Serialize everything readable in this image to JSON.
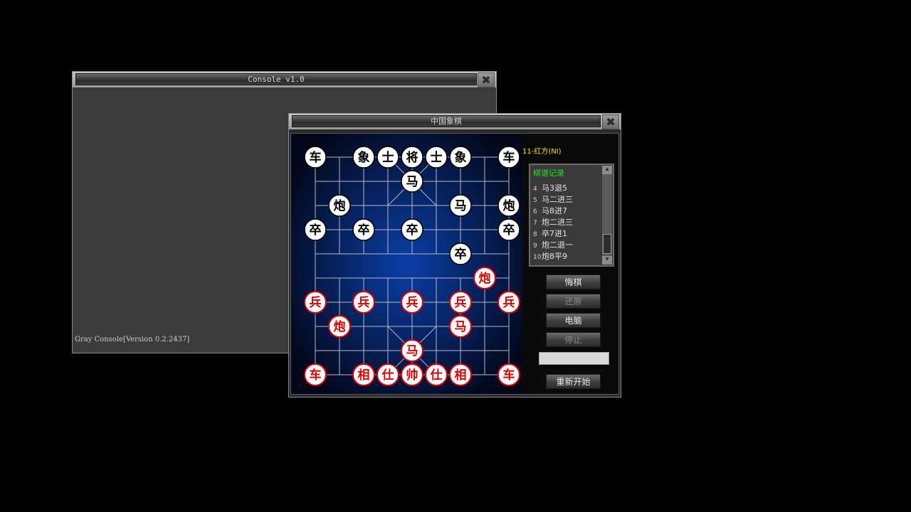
{
  "console": {
    "title": "Console v1.0",
    "close_glyph": "✖",
    "text": "Gray Console[Version 0.2.2437]"
  },
  "chess": {
    "title": "中国象棋",
    "close_glyph": "✖",
    "turn_label": "11-红方(NI)",
    "record": {
      "title": "棋谱记录",
      "moves": [
        {
          "num": "4",
          "text": "马3退5"
        },
        {
          "num": "5",
          "text": "马二进三"
        },
        {
          "num": "6",
          "text": "马8进7"
        },
        {
          "num": "7",
          "text": "炮二进三"
        },
        {
          "num": "8",
          "text": "卒7进1"
        },
        {
          "num": "9",
          "text": "炮二退一"
        },
        {
          "num": "10",
          "text": "炮8平9"
        }
      ],
      "scroll_up": "⯅",
      "scroll_down": "⯆"
    },
    "buttons": {
      "undo": "悔棋",
      "redo": "还原",
      "computer": "电脑",
      "stop": "停止",
      "restart": "重新开始"
    },
    "input_value": "",
    "colors": {
      "red": "#e00000",
      "black": "#000000",
      "board_center": "#0a3fa8",
      "board_edge": "#02071a",
      "line": "#b8b8c8"
    },
    "pieces": [
      {
        "char": "车",
        "side": "black",
        "col": 0,
        "row": 0
      },
      {
        "char": "象",
        "side": "black",
        "col": 2,
        "row": 0
      },
      {
        "char": "士",
        "side": "black",
        "col": 3,
        "row": 0
      },
      {
        "char": "将",
        "side": "black",
        "col": 4,
        "row": 0
      },
      {
        "char": "士",
        "side": "black",
        "col": 5,
        "row": 0
      },
      {
        "char": "象",
        "side": "black",
        "col": 6,
        "row": 0
      },
      {
        "char": "车",
        "side": "black",
        "col": 8,
        "row": 0
      },
      {
        "char": "马",
        "side": "black",
        "col": 4,
        "row": 1
      },
      {
        "char": "炮",
        "side": "black",
        "col": 1,
        "row": 2
      },
      {
        "char": "马",
        "side": "black",
        "col": 6,
        "row": 2
      },
      {
        "char": "炮",
        "side": "black",
        "col": 8,
        "row": 2
      },
      {
        "char": "卒",
        "side": "black",
        "col": 0,
        "row": 3
      },
      {
        "char": "卒",
        "side": "black",
        "col": 2,
        "row": 3
      },
      {
        "char": "卒",
        "side": "black",
        "col": 4,
        "row": 3
      },
      {
        "char": "卒",
        "side": "black",
        "col": 8,
        "row": 3
      },
      {
        "char": "卒",
        "side": "black",
        "col": 6,
        "row": 4
      },
      {
        "char": "炮",
        "side": "red",
        "col": 7,
        "row": 5
      },
      {
        "char": "兵",
        "side": "red",
        "col": 0,
        "row": 6
      },
      {
        "char": "兵",
        "side": "red",
        "col": 2,
        "row": 6
      },
      {
        "char": "兵",
        "side": "red",
        "col": 4,
        "row": 6
      },
      {
        "char": "兵",
        "side": "red",
        "col": 6,
        "row": 6
      },
      {
        "char": "兵",
        "side": "red",
        "col": 8,
        "row": 6
      },
      {
        "char": "炮",
        "side": "red",
        "col": 1,
        "row": 7
      },
      {
        "char": "马",
        "side": "red",
        "col": 6,
        "row": 7
      },
      {
        "char": "马",
        "side": "red",
        "col": 4,
        "row": 8
      },
      {
        "char": "车",
        "side": "red",
        "col": 0,
        "row": 9
      },
      {
        "char": "相",
        "side": "red",
        "col": 2,
        "row": 9
      },
      {
        "char": "仕",
        "side": "red",
        "col": 3,
        "row": 9
      },
      {
        "char": "帅",
        "side": "red",
        "col": 4,
        "row": 9
      },
      {
        "char": "仕",
        "side": "red",
        "col": 5,
        "row": 9
      },
      {
        "char": "相",
        "side": "red",
        "col": 6,
        "row": 9
      },
      {
        "char": "车",
        "side": "red",
        "col": 8,
        "row": 9
      }
    ]
  }
}
